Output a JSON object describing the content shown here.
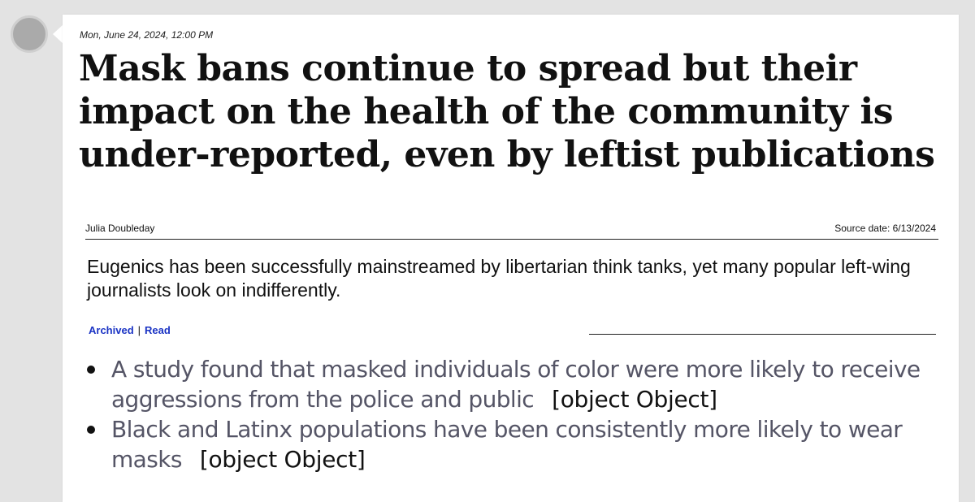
{
  "post": {
    "timestamp": "Mon, June 24, 2024, 12:00 PM",
    "headline": "Mask bans continue to spread but their impact on the health of the community is under-reported, even by leftist publications",
    "author": "Julia Doubleday",
    "source_date": "Source date: 6/13/2024",
    "summary": "Eugenics has been successfully mainstreamed by libertarian think tanks, yet many popular left-wing journalists look on indifferently.",
    "links": {
      "archived": "Archived",
      "separator": "|",
      "read": "Read"
    },
    "bullets": [
      {
        "text": "A study found that masked individuals of color were more likely to receive aggressions from the police and public",
        "ref": "[object Object]"
      },
      {
        "text": "Black and Latinx populations have been consistently more likely to wear masks",
        "ref": "[object Object]"
      }
    ]
  }
}
